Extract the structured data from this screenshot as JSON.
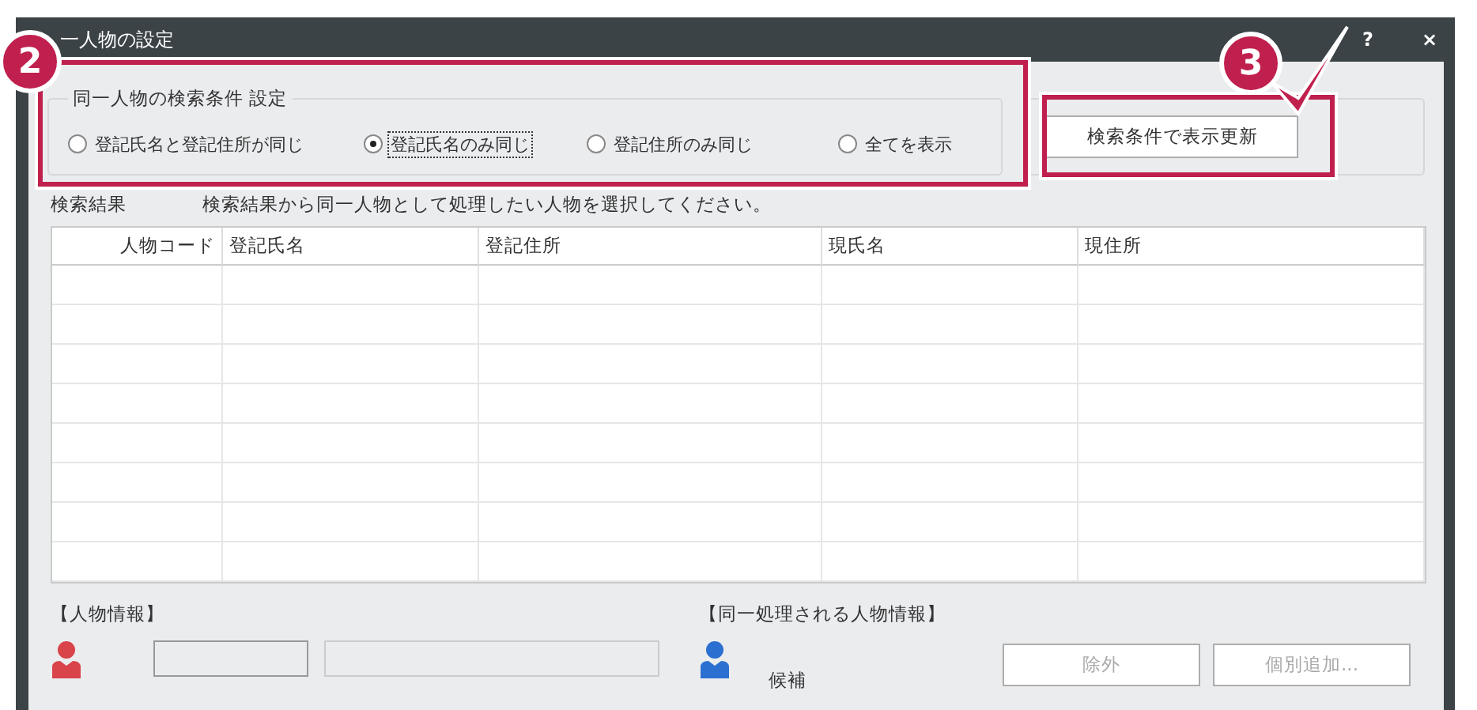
{
  "window": {
    "title": "一人物の設定",
    "title_buttons": [
      "?",
      "×"
    ]
  },
  "search_conditions": {
    "legend": "同一人物の検索条件  設定",
    "options": [
      {
        "label": "登記氏名と登記住所が同じ",
        "selected": false
      },
      {
        "label": "登記氏名のみ同じ",
        "selected": true
      },
      {
        "label": "登記住所のみ同じ",
        "selected": false
      },
      {
        "label": "全てを表示",
        "selected": false
      }
    ]
  },
  "refresh_button": {
    "label": "検索条件で表示更新"
  },
  "results": {
    "label": "検索結果",
    "instruction": "検索結果から同一人物として処理したい人物を選択してください。"
  },
  "table": {
    "columns": [
      "人物コード",
      "登記氏名",
      "登記住所",
      "現氏名",
      "現住所"
    ]
  },
  "person_info": {
    "heading": "【人物情報】"
  },
  "same_persons": {
    "heading": "【同一処理される人物情報】",
    "candidate_label": "候補",
    "buttons": [
      {
        "label": "除外",
        "disabled": true
      },
      {
        "label": "個別追加...",
        "disabled": true
      }
    ]
  },
  "annotations": [
    {
      "number": "2"
    },
    {
      "number": "3"
    }
  ]
}
